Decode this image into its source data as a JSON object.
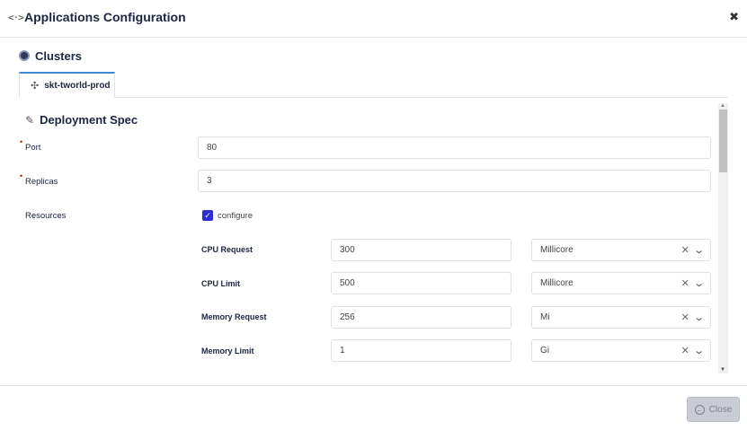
{
  "header": {
    "icon": "code-brackets-icon",
    "title": "Applications Configuration",
    "close_glyph": "✖"
  },
  "clusters": {
    "title": "Clusters",
    "tabs": [
      {
        "label": "skt-tworld-prod",
        "icon": "cluster-icon"
      }
    ]
  },
  "deployment_spec": {
    "title": "Deployment Spec",
    "port": {
      "label": "Port",
      "value": "80",
      "required": true
    },
    "replicas": {
      "label": "Replicas",
      "value": "3",
      "required": true
    },
    "resources": {
      "label": "Resources",
      "configure_label": "configure",
      "configure_checked": true,
      "rows": [
        {
          "label": "CPU Request",
          "value": "300",
          "unit": "Millicore"
        },
        {
          "label": "CPU Limit",
          "value": "500",
          "unit": "Millicore"
        },
        {
          "label": "Memory Request",
          "value": "256",
          "unit": "Mi"
        },
        {
          "label": "Memory Limit",
          "value": "1",
          "unit": "Gi"
        }
      ]
    }
  },
  "footer": {
    "close_label": "Close"
  },
  "colors": {
    "accent": "#2d2fd0",
    "tab_active": "#3d8bd4",
    "required": "#dd1111",
    "button_disabled": "#c9cdd3"
  }
}
